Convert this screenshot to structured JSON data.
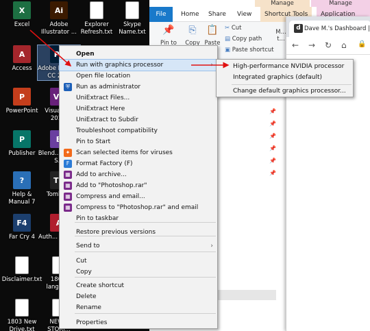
{
  "desktop": {
    "icons": [
      {
        "label": "Excel",
        "color": "#1d6f42",
        "glyph": "X"
      },
      {
        "label": "Adobe Illustrator ...",
        "color": "#3b1a00",
        "glyph": "Ai"
      },
      {
        "label": "Explorer Refresh.txt",
        "color": "#ffffff",
        "glyph": ""
      },
      {
        "label": "Skype Name.txt",
        "color": "#ffffff",
        "glyph": ""
      },
      {
        "label": "Access",
        "color": "#a4262c",
        "glyph": "A"
      },
      {
        "label": "Adobe Photo... CC 20...",
        "color": "#001e36",
        "glyph": "Ps"
      },
      {
        "label": "PowerPoint",
        "color": "#c43e1c",
        "glyph": "P"
      },
      {
        "label": "Visual S... 201...",
        "color": "#68217a",
        "glyph": "VS"
      },
      {
        "label": "Publisher",
        "color": "#077568",
        "glyph": "P"
      },
      {
        "label": "Blend... Visual S...",
        "color": "#6a3fa0",
        "glyph": "B"
      },
      {
        "label": "Help & Manual 7",
        "color": "#2a6fb7",
        "glyph": "?"
      },
      {
        "label": "TombR...",
        "color": "#222222",
        "glyph": "TR"
      },
      {
        "label": "Far Cry 4",
        "color": "#1c3f6e",
        "glyph": "F4"
      },
      {
        "label": "Auth... Desk...",
        "color": "#b01e2e",
        "glyph": "A"
      },
      {
        "label": "Disclaimer.txt",
        "color": "#ffffff",
        "glyph": ""
      },
      {
        "label": "180... langua...",
        "color": "#ffffff",
        "glyph": ""
      },
      {
        "label": "1803 New Drive.txt",
        "color": "#ffffff",
        "glyph": ""
      },
      {
        "label": "NEW... STORI...",
        "color": "#ffffff",
        "glyph": ""
      }
    ]
  },
  "explorer": {
    "tabs": [
      "File",
      "Home",
      "Share",
      "View",
      "Shortcut Tools",
      "Application Tools"
    ],
    "manage": [
      "Manage",
      "Manage"
    ],
    "ribbon": {
      "pin": "Pin to Quick",
      "copy": "Copy",
      "paste": "Paste",
      "cut": "Cut",
      "copy_path": "Copy path",
      "paste_shortcut": "Paste shortcut",
      "move": "M... t..."
    }
  },
  "chrome": {
    "tab_title": "Dave M.'s Dashboard | D",
    "favicon": "d"
  },
  "context_menu": {
    "items": [
      {
        "label": "Open",
        "bold": true,
        "icon": ""
      },
      {
        "label": "Run with graphics processor",
        "submenu": true,
        "icon": "",
        "highlight": true
      },
      {
        "label": "Open file location",
        "icon": ""
      },
      {
        "label": "Run as administrator",
        "icon": "shield"
      },
      {
        "label": "UniExtract Files...",
        "icon": ""
      },
      {
        "label": "UniExtract Here",
        "icon": ""
      },
      {
        "label": "UniExtract to Subdir",
        "icon": ""
      },
      {
        "label": "Troubleshoot compatibility",
        "icon": ""
      },
      {
        "label": "Pin to Start",
        "icon": ""
      },
      {
        "label": "Scan selected items for viruses",
        "icon": "avast"
      },
      {
        "label": "Format Factory (F)",
        "icon": "ff"
      },
      {
        "label": "Add to archive...",
        "icon": "rar"
      },
      {
        "label": "Add to \"Photoshop.rar\"",
        "icon": "rar"
      },
      {
        "label": "Compress and email...",
        "icon": "rar"
      },
      {
        "label": "Compress to \"Photoshop.rar\" and email",
        "icon": "rar"
      },
      {
        "label": "Pin to taskbar",
        "icon": ""
      },
      {
        "label": "Restore previous versions",
        "icon": ""
      },
      {
        "label": "Send to",
        "submenu": true,
        "icon": ""
      },
      {
        "label": "Cut",
        "icon": ""
      },
      {
        "label": "Copy",
        "icon": ""
      },
      {
        "label": "Create shortcut",
        "icon": ""
      },
      {
        "label": "Delete",
        "icon": ""
      },
      {
        "label": "Rename",
        "icon": ""
      },
      {
        "label": "Properties",
        "icon": ""
      }
    ]
  },
  "submenu": {
    "items": [
      {
        "label": "High-performance NVIDIA processor"
      },
      {
        "label": "Integrated graphics (default)"
      },
      {
        "label": "Change default graphics processor..."
      }
    ]
  },
  "colors": {
    "accent": "#1979ca",
    "arrow": "#e01010",
    "menu_bg": "#f2f2f2",
    "highlight": "#d6e6f7"
  }
}
